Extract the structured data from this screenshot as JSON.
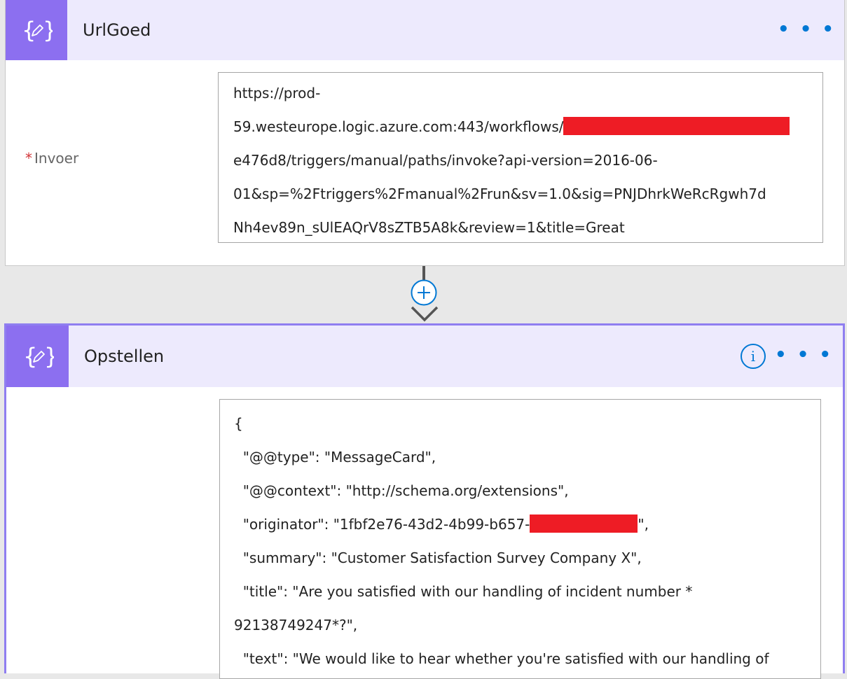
{
  "card1": {
    "title": "UrlGoed",
    "field_required": "*",
    "field_label": "Invoer",
    "value_lines": [
      "https://prod-",
      "59.westeurope.logic.azure.com:443/workflows/",
      "e476d8/triggers/manual/paths/invoke?api-version=2016-06-",
      "01&sp=%2Ftriggers%2Fmanual%2Frun&sv=1.0&sig=PNJDhrkWeRcRgwh7d",
      "Nh4ev89n_sUlEAQrV8sZTB5A8k&review=1&title=Great"
    ],
    "more_icon": "ellipsis-icon"
  },
  "connector": {
    "icon": "plus-circle-icon",
    "arrow_icon": "chevron-down-icon"
  },
  "card2": {
    "title": "Opstellen",
    "info_icon": "info-icon",
    "info_glyph": "i",
    "more_icon": "ellipsis-icon",
    "value_lines": [
      "{",
      "  \"@@type\": \"MessageCard\",",
      "  \"@@context\": \"http://schema.org/extensions\",",
      "  \"originator\": \"1fbf2e76-43d2-4b99-b657-",
      "  \"summary\": \"Customer Satisfaction Survey Company X\",",
      "  \"title\": \"Are you satisfied with our handling of incident number *",
      "92138749247*?\",",
      "  \"text\": \"We would like to hear whether you're satisfied with our handling of"
    ],
    "originator_suffix": "\","
  },
  "colors": {
    "accent": "#8c6ff0",
    "header_bg": "#edeafd",
    "selected_border": "#8f7ef0",
    "link_blue": "#0078d4",
    "redaction": "#ee1c25",
    "required": "#d13438"
  }
}
